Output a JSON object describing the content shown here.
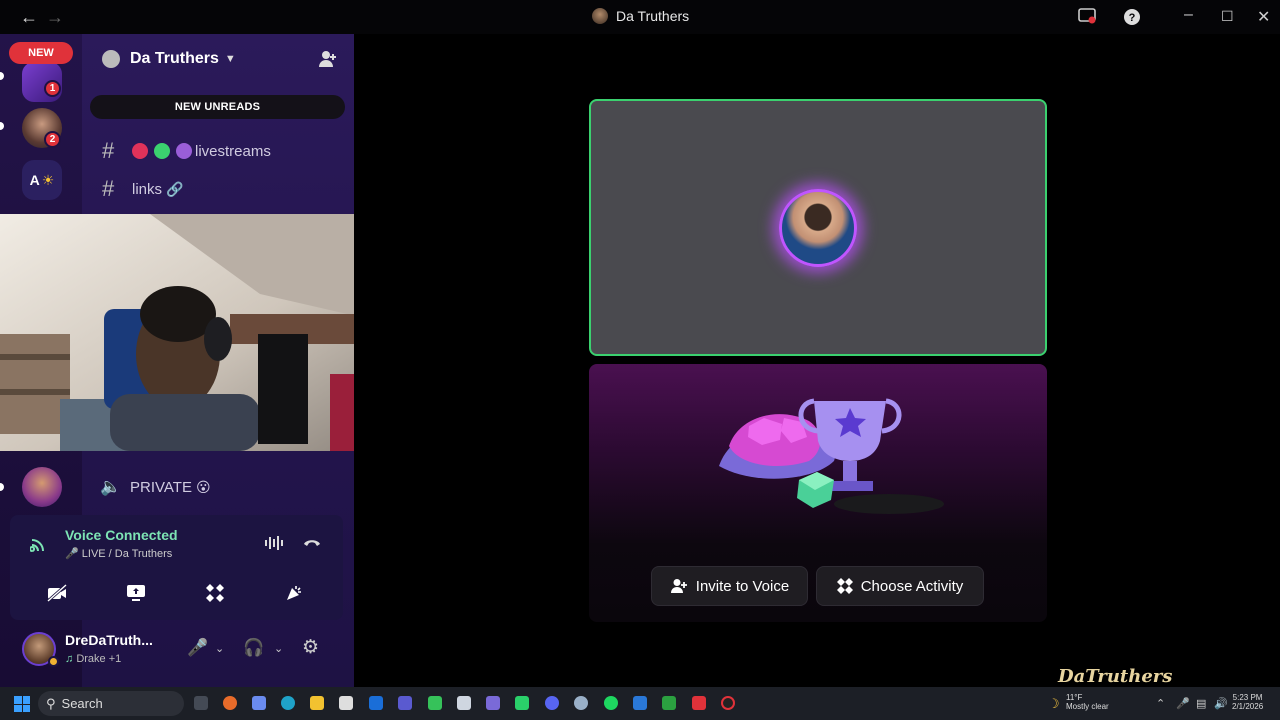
{
  "titlebar": {
    "title": "Da Truthers",
    "back_icon": "arrow-left-icon",
    "forward_icon": "arrow-right-icon",
    "help_icon": "question-icon"
  },
  "rail": {
    "new_pill": "NEW",
    "servers": [
      {
        "name": "purple-server",
        "badge": "1"
      },
      {
        "name": "headset-server",
        "badge": "2"
      },
      {
        "name": "a-sun-server",
        "label": "A"
      },
      {
        "name": "private-server"
      }
    ]
  },
  "guild": {
    "name": "Da Truthers",
    "new_unreads": "NEW UNREADS",
    "channels": [
      {
        "label": "livestreams"
      },
      {
        "label": "links"
      }
    ],
    "private_channel": "PRIVATE"
  },
  "voice": {
    "status": "Voice Connected",
    "channel": "LIVE / Da Truthers"
  },
  "user": {
    "name": "DreDaTruth...",
    "activity": "Drake +1"
  },
  "stage": {
    "invite_button": "Invite to Voice",
    "activity_button": "Choose Activity"
  },
  "brand": "DaTruthers",
  "taskbar": {
    "search": "Search",
    "weather_temp": "11°F",
    "weather_text": "Mostly clear",
    "time": "5:23 PM",
    "date": "2/1/2026"
  },
  "colors": {
    "accent_green": "#3bd16f",
    "voice_green": "#7de4b4",
    "badge_red": "#e0323a",
    "rail_bg": "#231349"
  }
}
